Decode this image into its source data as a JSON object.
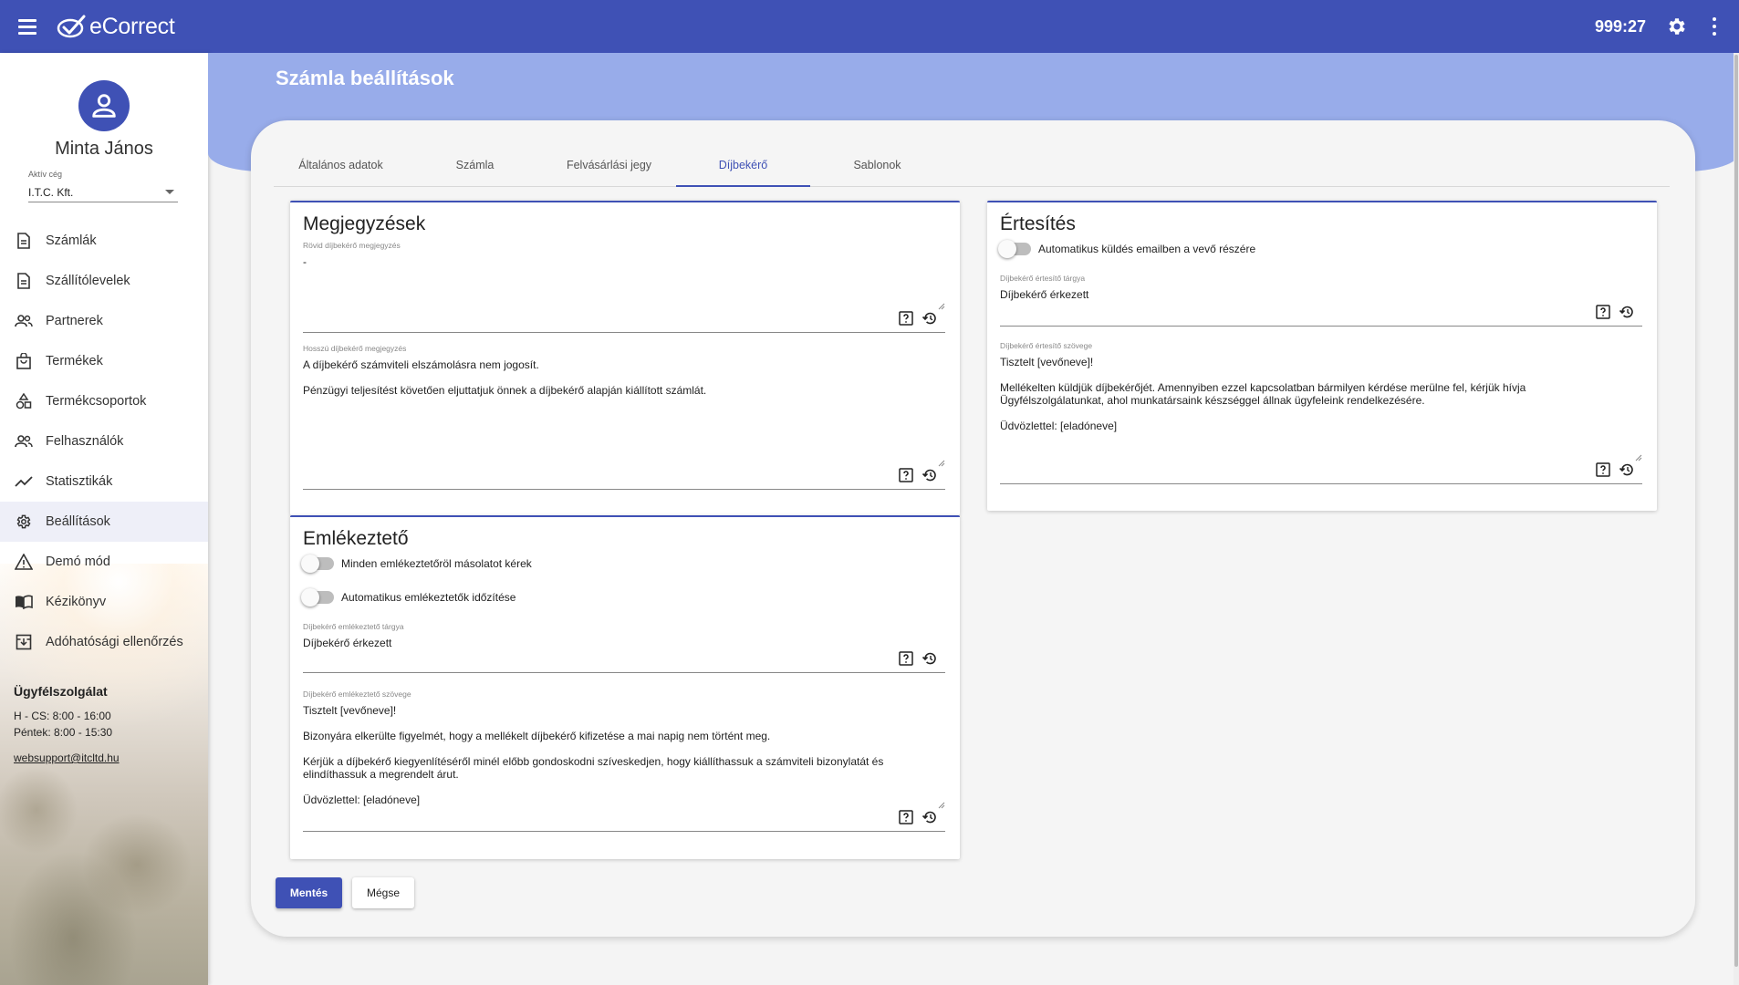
{
  "app": {
    "name": "eCorrect",
    "timer": "999:27"
  },
  "sidebar": {
    "user_name": "Minta János",
    "company_label": "Aktív cég",
    "company_value": "I.T.C. Kft.",
    "items": [
      {
        "label": "Számlák",
        "icon": "document-icon"
      },
      {
        "label": "Szállítólevelek",
        "icon": "document-icon"
      },
      {
        "label": "Partnerek",
        "icon": "people-icon"
      },
      {
        "label": "Termékek",
        "icon": "shopping-bag-icon"
      },
      {
        "label": "Termékcsoportok",
        "icon": "category-icon"
      },
      {
        "label": "Felhasználók",
        "icon": "people-icon"
      },
      {
        "label": "Statisztikák",
        "icon": "trending-icon"
      },
      {
        "label": "Beállítások",
        "icon": "gear-icon"
      },
      {
        "label": "Demó mód",
        "icon": "warning-icon"
      },
      {
        "label": "Kézikönyv",
        "icon": "book-icon"
      },
      {
        "label": "Adóhatósági ellenőrzés",
        "icon": "archive-icon"
      }
    ],
    "active_item": "Beállítások",
    "support": {
      "heading": "Ügyfélszolgálat",
      "hours_1": "H - CS: 8:00 - 16:00",
      "hours_2": "Péntek: 8:00 - 15:30",
      "email": "websupport@itcltd.hu"
    }
  },
  "page": {
    "title": "Számla beállítások",
    "tabs": [
      "Általános adatok",
      "Számla",
      "Felvásárlási jegy",
      "Díjbekérő",
      "Sablonok"
    ],
    "active_tab": "Díjbekérő"
  },
  "megjegyzesek": {
    "title": "Megjegyzések",
    "short_label": "Rövid díjbekérő megjegyzés",
    "short_value": "-",
    "long_label": "Hosszú díjbekérő megjegyzés",
    "long_value": "A díjbekérő számviteli elszámolásra nem jogosít.\n\nPénzügyi teljesítést követően eljuttatjuk önnek a díjbekérő alapján kiállított számlát."
  },
  "emlekezteto": {
    "title": "Emlékeztető",
    "toggle_copy": "Minden emlékeztetőröl másolatot kérek",
    "toggle_auto": "Automatikus emlékeztetők időzítése",
    "subject_label": "Díjbekérő emlékeztető tárgya",
    "subject_value": "Díjbekérő érkezett",
    "body_label": "Díjbekérő emlékeztető szövege",
    "body_value": "Tisztelt [vevőneve]!\n\nBizonyára elkerülte figyelmét, hogy a mellékelt díjbekérő kifizetése a mai napig nem történt meg.\n\nKérjük a díjbekérő kiegyenlítéséről minél előbb gondoskodni szíveskedjen, hogy kiállíthassuk a számviteli bizonylatát és\nelindíthassuk a megrendelt árut.\n\nÜdvözlettel: [eladóneve]"
  },
  "ertesites": {
    "title": "Értesítés",
    "toggle_auto": "Automatikus küldés emailben a vevő részére",
    "subject_label": "Díjbekérő értesítő tárgya",
    "subject_value": "Díjbekérő érkezett",
    "body_label": "Díjbekérő értesítő szövege",
    "body_value": "Tisztelt [vevőneve]!\n\nMellékelten küldjük díjbekérőjét. Amennyiben ezzel kapcsolatban bármilyen kérdése merülne fel, kérjük hívja\nÜgyfélszolgálatunkat, ahol munkatársaink készséggel állnak ügyfeleink rendelkezésére.\n\nÜdvözlettel: [eladóneve]"
  },
  "buttons": {
    "save": "Mentés",
    "cancel": "Mégse"
  },
  "colors": {
    "primary": "#3f51b5",
    "band": "#98acea"
  }
}
